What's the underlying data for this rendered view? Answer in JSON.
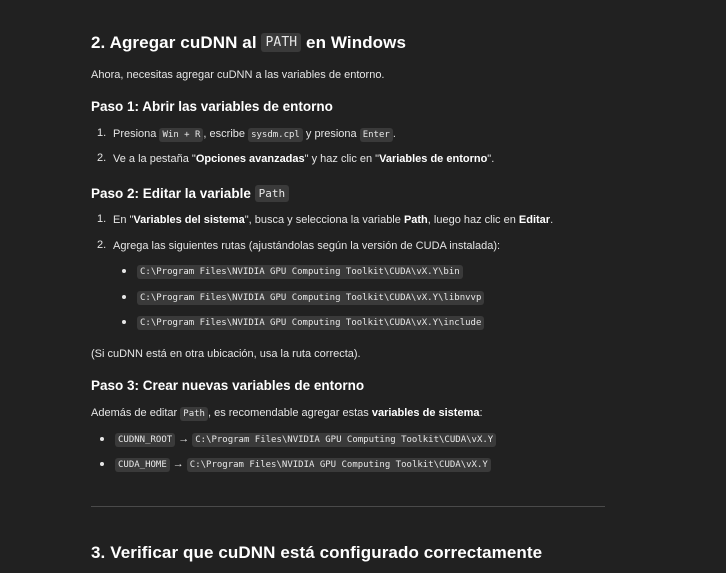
{
  "section2": {
    "title_pre": "2. Agregar cuDNN al ",
    "title_code": "PATH",
    "title_post": " en Windows",
    "intro": "Ahora, necesitas agregar cuDNN a las variables de entorno."
  },
  "paso1": {
    "title": "Paso 1: Abrir las variables de entorno",
    "item1": {
      "num": "1.",
      "t1": "Presiona ",
      "code1": "Win + R",
      "t2": ", escribe ",
      "code2": "sysdm.cpl",
      "t3": " y presiona ",
      "code3": "Enter",
      "t4": "."
    },
    "item2": {
      "num": "2.",
      "t1": "Ve a la pestaña \"",
      "b1": "Opciones avanzadas",
      "t2": "\" y haz clic en \"",
      "b2": "Variables de entorno",
      "t3": "\"."
    }
  },
  "paso2": {
    "title_pre": "Paso 2: Editar la variable ",
    "title_code": "Path",
    "item1": {
      "num": "1.",
      "t1": "En \"",
      "b1": "Variables del sistema",
      "t2": "\", busca y selecciona la variable ",
      "b2": "Path",
      "t3": ", luego haz clic en ",
      "b3": "Editar",
      "t4": "."
    },
    "item2": {
      "num": "2.",
      "text": "Agrega las siguientes rutas (ajustándolas según la versión de CUDA instalada):"
    },
    "paths": [
      "C:\\Program Files\\NVIDIA GPU Computing Toolkit\\CUDA\\vX.Y\\bin",
      "C:\\Program Files\\NVIDIA GPU Computing Toolkit\\CUDA\\vX.Y\\libnvvp",
      "C:\\Program Files\\NVIDIA GPU Computing Toolkit\\CUDA\\vX.Y\\include"
    ],
    "note": "(Si cuDNN está en otra ubicación, usa la ruta correcta)."
  },
  "paso3": {
    "title": "Paso 3: Crear nuevas variables de entorno",
    "intro_t1": "Además de editar ",
    "intro_code": "Path",
    "intro_t2": ", es recomendable agregar estas ",
    "intro_b": "variables de sistema",
    "intro_t3": ":",
    "vars": [
      {
        "name": "CUDNN_ROOT",
        "arrow": "→",
        "value": "C:\\Program Files\\NVIDIA GPU Computing Toolkit\\CUDA\\vX.Y"
      },
      {
        "name": "CUDA_HOME",
        "arrow": "→",
        "value": "C:\\Program Files\\NVIDIA GPU Computing Toolkit\\CUDA\\vX.Y"
      }
    ]
  },
  "section3": {
    "title": "3. Verificar que cuDNN está configurado correctamente"
  }
}
